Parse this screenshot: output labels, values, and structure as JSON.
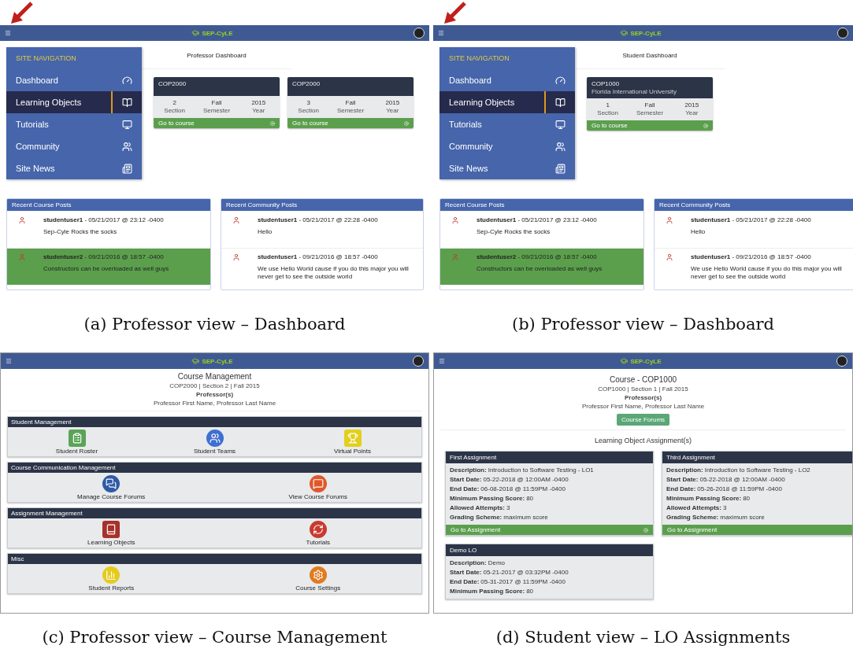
{
  "panels": [
    {
      "kind": "dashboard",
      "caption": "(a) Professor view – Dashboard",
      "brand": "SEP-CyLE",
      "pointer_arrow": true,
      "nav": {
        "heading": "SITE NAVIGATION",
        "items": [
          {
            "label": "Dashboard",
            "selected": false
          },
          {
            "label": "Learning Objects",
            "selected": true
          },
          {
            "label": "Tutorials",
            "selected": false
          },
          {
            "label": "Community",
            "selected": false
          },
          {
            "label": "Site News",
            "selected": false
          }
        ]
      },
      "page_title": "Professor Dashboard",
      "courses": [
        {
          "code": "COP2000",
          "stats": [
            {
              "value": "2",
              "label": "Section"
            },
            {
              "value": "Fall",
              "label": "Semester"
            },
            {
              "value": "2015",
              "label": "Year"
            }
          ],
          "link": "Go to course"
        },
        {
          "code": "COP2000",
          "stats": [
            {
              "value": "3",
              "label": "Section"
            },
            {
              "value": "Fall",
              "label": "Semester"
            },
            {
              "value": "2015",
              "label": "Year"
            }
          ],
          "link": "Go to course"
        }
      ],
      "feeds": [
        {
          "title": "Recent Course Posts",
          "posts": [
            {
              "author": "studentuser1",
              "meta": "- 05/21/2017 @ 23:12 -0400",
              "text": "Sep-Cyle Rocks the socks",
              "highlighted": false
            },
            {
              "author": "studentuser2",
              "meta": "- 09/21/2016 @ 18:57 -0400",
              "text": "Constructors can be overloaded as well guys",
              "highlighted": true
            }
          ]
        },
        {
          "title": "Recent Community Posts",
          "posts": [
            {
              "author": "studentuser1",
              "meta": "- 05/21/2017 @ 22:28 -0400",
              "text": "Hello",
              "highlighted": false
            },
            {
              "author": "studentuser1",
              "meta": "- 09/21/2016 @ 18:57 -0400",
              "text": "We use Hello World cause if you do this major you will never get to see the outside world",
              "highlighted": false
            }
          ]
        }
      ]
    },
    {
      "kind": "dashboard",
      "caption": "(b) Professor view – Dashboard",
      "brand": "SEP-CyLE",
      "pointer_arrow": true,
      "nav": {
        "heading": "SITE NAVIGATION",
        "items": [
          {
            "label": "Dashboard",
            "selected": false
          },
          {
            "label": "Learning Objects",
            "selected": true
          },
          {
            "label": "Tutorials",
            "selected": false
          },
          {
            "label": "Community",
            "selected": false
          },
          {
            "label": "Site News",
            "selected": false
          }
        ]
      },
      "page_title": "Student Dashboard",
      "courses": [
        {
          "code": "COP1000",
          "subtitle": "Florida International University",
          "stats": [
            {
              "value": "1",
              "label": "Section"
            },
            {
              "value": "Fall",
              "label": "Semester"
            },
            {
              "value": "2015",
              "label": "Year"
            }
          ],
          "link": "Go to course"
        }
      ],
      "feeds": [
        {
          "title": "Recent Course Posts",
          "posts": [
            {
              "author": "studentuser1",
              "meta": "- 05/21/2017 @ 23:12 -0400",
              "text": "Sep-Cyle Rocks the socks",
              "highlighted": false
            },
            {
              "author": "studentuser2",
              "meta": "- 09/21/2016 @ 18:57 -0400",
              "text": "Constructors can be overloaded as well guys",
              "highlighted": true
            }
          ]
        },
        {
          "title": "Recent Community Posts",
          "posts": [
            {
              "author": "studentuser1",
              "meta": "- 05/21/2017 @ 22:28 -0400",
              "text": "Hello",
              "highlighted": false
            },
            {
              "author": "studentuser1",
              "meta": "- 09/21/2016 @ 18:57 -0400",
              "text": "We use Hello World cause if you do this major you will never get to see the outside world",
              "highlighted": false
            }
          ]
        }
      ]
    },
    {
      "kind": "management",
      "caption": "(c) Professor view – Course Management",
      "brand": "SEP-CyLE",
      "page_title": "Course Management",
      "course_meta": "COP2000 | Section 2 | Fall 2015",
      "professors_label": "Professor(s)",
      "professors": "Professor First Name, Professor Last Name",
      "sections": [
        {
          "title": "Student Management",
          "tools": [
            {
              "kind": "roster",
              "label": "Student Roster"
            },
            {
              "kind": "teams",
              "label": "Student Teams"
            },
            {
              "kind": "points",
              "label": "Virtual Points"
            }
          ]
        },
        {
          "title": "Course Communication Management",
          "tools": [
            {
              "kind": "forum-manage",
              "label": "Manage Course Forums"
            },
            {
              "kind": "forum-view",
              "label": "View Course Forums"
            }
          ]
        },
        {
          "title": "Assignment Management",
          "tools": [
            {
              "kind": "learning-objects",
              "label": "Learning Objects"
            },
            {
              "kind": "tutorials",
              "label": "Tutorials"
            }
          ]
        },
        {
          "title": "Misc",
          "tools": [
            {
              "kind": "reports",
              "label": "Student Reports"
            },
            {
              "kind": "settings",
              "label": "Course Settings"
            }
          ]
        }
      ]
    },
    {
      "kind": "assignments",
      "caption": "(d) Student view – LO Assignments",
      "brand": "SEP-CyLE",
      "page_title": "Course - COP1000",
      "course_meta": "COP1000 | Section 1 | Fall 2015",
      "professors_label": "Professor(s)",
      "professors": "Professor First Name, Professor Last Name",
      "forum_button": "Course Forums",
      "section_title": "Learning Object Assignment(s)",
      "assignments": [
        {
          "title": "First Assignment",
          "fields": [
            {
              "label": "Description:",
              "value": "Introduction to Software Testing - LO1"
            },
            {
              "label": "Start Date:",
              "value": "05-22-2018 @ 12:00AM -0400"
            },
            {
              "label": "End Date:",
              "value": "06-08-2018 @ 11:59PM -0400"
            },
            {
              "label": "Minimum Passing Score:",
              "value": "80"
            },
            {
              "label": "Allowed Attempts:",
              "value": "3"
            },
            {
              "label": "Grading Scheme:",
              "value": "maximum score"
            }
          ],
          "link": "Go to Assignment"
        },
        {
          "title": "Third Assignment",
          "fields": [
            {
              "label": "Description:",
              "value": "Introduction to Software Testing - LO2"
            },
            {
              "label": "Start Date:",
              "value": "05-22-2018 @ 12:00AM -0400"
            },
            {
              "label": "End Date:",
              "value": "05-26-2018 @ 11:59PM -0400"
            },
            {
              "label": "Minimum Passing Score:",
              "value": "80"
            },
            {
              "label": "Allowed Attempts:",
              "value": "3"
            },
            {
              "label": "Grading Scheme:",
              "value": "maximum score"
            }
          ],
          "link": "Go to Assignment"
        },
        {
          "title": "Demo LO",
          "fields": [
            {
              "label": "Description:",
              "value": "Demo"
            },
            {
              "label": "Start Date:",
              "value": "05-21-2017 @ 03:32PM -0400"
            },
            {
              "label": "End Date:",
              "value": "05-31-2017 @ 11:59PM -0400"
            },
            {
              "label": "Minimum Passing Score:",
              "value": "80"
            }
          ]
        }
      ]
    }
  ]
}
